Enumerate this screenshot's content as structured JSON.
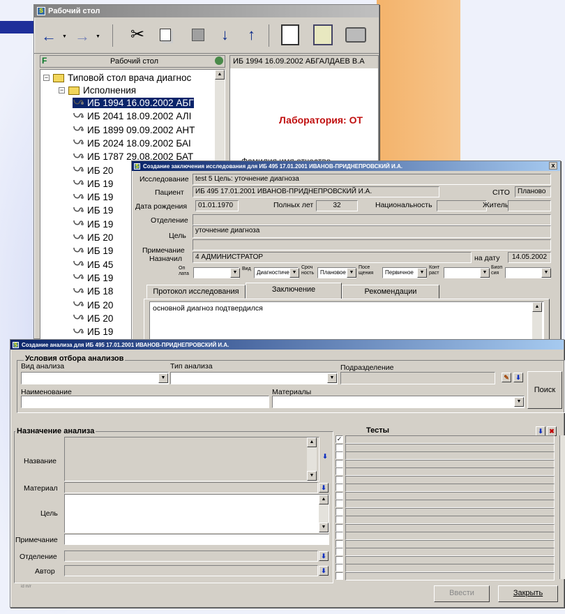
{
  "background": {
    "accent": "#1e2f9a",
    "orange": "#f4b36b"
  },
  "desktop_window": {
    "title": "Рабочий стол",
    "panel_title": "Рабочий стол",
    "header_text": "ИБ  1994  16.09.2002  АБГАЛДАЕВ В.А",
    "lab_text": "Лаборатория: ОТ",
    "fio_text": "Фамилия имя отчество",
    "tree": {
      "root": "Типовой стол врача диагнос",
      "folder": "Исполнения",
      "items": [
        "ИБ  1994  16.09.2002  АБГ",
        "ИБ  2041  18.09.2002  АЛІ",
        "ИБ  1899  09.09.2002  АНТ",
        "ИБ  2024  18.09.2002  БАІ",
        "ИБ  1787  29.08.2002  БАТ",
        "ИБ  20",
        "ИБ  19",
        "ИБ  19",
        "ИБ  19",
        "ИБ  19",
        "ИБ  20",
        "ИБ  19",
        "ИБ  45",
        "ИБ  19",
        "ИБ  18",
        "ИБ  20",
        "ИБ  20",
        "ИБ  19"
      ]
    }
  },
  "conclusion_window": {
    "title": "Создание заключения исследования для  ИБ  495  17.01.2001  ИВАНОВ-ПРИДНЕПРОВСКИЙ И.А.",
    "close": "x",
    "labels": {
      "research": "Исследование",
      "patient": "Пациент",
      "birth": "Дата рождения",
      "full_years": "Полных лет",
      "nationality": "Национальность",
      "resident": "Житель",
      "department": "Отделение",
      "goal": "Цель",
      "note": "Примечание",
      "assigned": "Назначил",
      "on_date": "на дату",
      "op": "Оп лата",
      "vid": "Вид",
      "srok": "Сроч ность",
      "pose": "Посе щения",
      "kont": "Конт раст",
      "biop": "Биоп сия"
    },
    "values": {
      "research": "test 5 Цель: уточнение диагноза",
      "patient": "ИБ  495  17.01.2001  ИВАНОВ-ПРИДНЕПРОВСКИЙ И.А.",
      "cito": "CITO",
      "cito_value": "Планово",
      "birth": "01.01.1970",
      "age": "32",
      "goal": "уточнение диагноза",
      "assigned": "4 АДМИНИСТРАТОР",
      "date": "14.05.2002",
      "vid": "Диагностиче",
      "srok": "Плановое",
      "pose": "Первичное"
    },
    "tabs": [
      "Протокол исследования",
      "Заключение",
      "Рекомендации"
    ],
    "text": "основной диагноз подтвердился"
  },
  "analysis_window": {
    "title": "Создание анализа для  ИБ  495  17.01.2001  ИВАНОВ-ПРИДНЕПРОВСКИЙ И.А.",
    "filter_group": "Условия отбора анализов",
    "labels": {
      "kind": "Вид анализа",
      "type": "Тип анализа",
      "division": "Подразделение",
      "name": "Наименование",
      "materials": "Материалы"
    },
    "search_button": "Поиск",
    "assign_group": "Назначение анализа",
    "assign_labels": {
      "name": "Название",
      "material": "Материал",
      "goal": "Цель",
      "note": "Примечание",
      "department": "Отделение",
      "author": "Автор"
    },
    "tests_title": "Тесты",
    "test_rows": 18,
    "footer_small": "id   m/r",
    "enter_button": "Ввести",
    "close_button": "Закрыть"
  }
}
